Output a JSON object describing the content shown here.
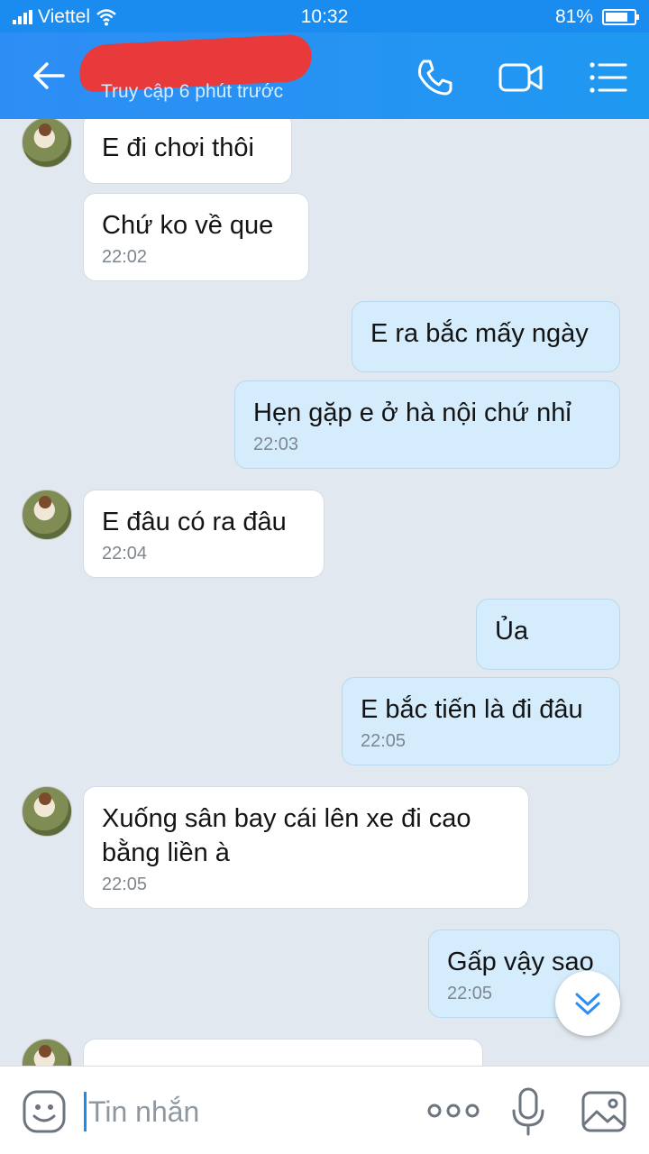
{
  "status_bar": {
    "carrier": "Viettel",
    "time": "10:32",
    "battery_text": "81%",
    "battery_level": 0.81
  },
  "header": {
    "subtitle": "Truy cập 6 phút trước"
  },
  "messages": [
    {
      "text": "E đi chơi thôi",
      "time": ""
    },
    {
      "text": "Chứ ko về que",
      "time": "22:02"
    },
    {
      "text": "E ra bắc mấy ngày",
      "time": ""
    },
    {
      "text": "Hẹn gặp e ở hà nội chứ nhỉ",
      "time": "22:03"
    },
    {
      "text": "E đâu có ra đâu",
      "time": "22:04"
    },
    {
      "text": "Ủa",
      "time": ""
    },
    {
      "text": "E bắc tiến là đi đâu",
      "time": "22:05"
    },
    {
      "text": "Xuống sân bay cái lên xe đi cao bằng liền à",
      "time": "22:05"
    },
    {
      "text": "Gấp vậy sao",
      "time": "22:05"
    },
    {
      "text": "",
      "time": ""
    }
  ],
  "composer": {
    "placeholder": "Tin nhắn"
  },
  "colors": {
    "header": "#2e8df4",
    "incoming_bubble": "#ffffff",
    "outgoing_bubble": "#d4ecfc",
    "background": "#e1e8ef"
  }
}
